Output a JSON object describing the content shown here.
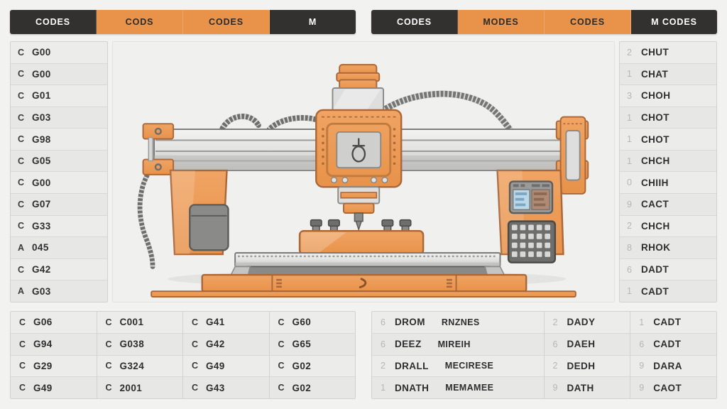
{
  "theme": {
    "accent": "#e8924a",
    "dark": "#333130",
    "background": "#f2f2f0",
    "row_light": "#ececea",
    "row_alt": "#e7e7e5",
    "border": "#d2d2d0",
    "text": "#2e2e2e",
    "faint_text": "#b6b6b4",
    "steel_light": "#e9e9e7",
    "steel_mid": "#b8b8b6",
    "steel_dark": "#6e6e6c"
  },
  "header": {
    "left_tabs": [
      {
        "label": "CODES",
        "style": "dark"
      },
      {
        "label": "CODS",
        "style": "accent"
      },
      {
        "label": "CODES",
        "style": "accent"
      },
      {
        "label": "M",
        "style": "dark"
      }
    ],
    "right_tabs": [
      {
        "label": "CODES",
        "style": "dark"
      },
      {
        "label": "MODES",
        "style": "accent"
      },
      {
        "label": "CODES",
        "style": "accent"
      },
      {
        "label": "M CODES",
        "style": "dark"
      }
    ]
  },
  "left_sidebar": {
    "rows": [
      {
        "prefix": "C",
        "value": "G00"
      },
      {
        "prefix": "C",
        "value": "G00"
      },
      {
        "prefix": "C",
        "value": "G01"
      },
      {
        "prefix": "C",
        "value": "G03"
      },
      {
        "prefix": "C",
        "value": "G98"
      },
      {
        "prefix": "C",
        "value": "G05"
      },
      {
        "prefix": "C",
        "value": "G00"
      },
      {
        "prefix": "C",
        "value": "G07"
      },
      {
        "prefix": "C",
        "value": "G33"
      },
      {
        "prefix": "A",
        "value": "045"
      },
      {
        "prefix": "C",
        "value": "G42"
      },
      {
        "prefix": "A",
        "value": "G03"
      }
    ]
  },
  "right_sidebar": {
    "rows": [
      {
        "prefix": "2",
        "value": "CHUT"
      },
      {
        "prefix": "1",
        "value": "CHAT"
      },
      {
        "prefix": "3",
        "value": "CHOH"
      },
      {
        "prefix": "1",
        "value": "CHOT"
      },
      {
        "prefix": "1",
        "value": "CHOT"
      },
      {
        "prefix": "1",
        "value": "CHCH"
      },
      {
        "prefix": "0",
        "value": "CHIIH"
      },
      {
        "prefix": "9",
        "value": "CACT"
      },
      {
        "prefix": "2",
        "value": "CHCH"
      },
      {
        "prefix": "8",
        "value": "RHOK"
      },
      {
        "prefix": "6",
        "value": "DADT"
      },
      {
        "prefix": "1",
        "value": "CADT"
      }
    ]
  },
  "bottom_left_panel": {
    "columns": [
      {
        "rows": [
          {
            "prefix": "C",
            "value": "G06"
          },
          {
            "prefix": "C",
            "value": "G94"
          },
          {
            "prefix": "C",
            "value": "G29"
          },
          {
            "prefix": "C",
            "value": "G49"
          }
        ]
      },
      {
        "rows": [
          {
            "prefix": "C",
            "value": "C001"
          },
          {
            "prefix": "C",
            "value": "G038"
          },
          {
            "prefix": "C",
            "value": "G324"
          },
          {
            "prefix": "C",
            "value": "2001"
          }
        ]
      },
      {
        "rows": [
          {
            "prefix": "C",
            "value": "G41"
          },
          {
            "prefix": "C",
            "value": "G42"
          },
          {
            "prefix": "C",
            "value": "G49"
          },
          {
            "prefix": "C",
            "value": "G43"
          }
        ]
      },
      {
        "rows": [
          {
            "prefix": "C",
            "value": "G60"
          },
          {
            "prefix": "C",
            "value": "G65"
          },
          {
            "prefix": "C",
            "value": "G02"
          },
          {
            "prefix": "C",
            "value": "G02"
          }
        ]
      }
    ]
  },
  "bottom_right_panel": {
    "columns": [
      {
        "rows": [
          {
            "prefix": "6",
            "value": "DROM",
            "secondary": "RNZNES"
          },
          {
            "prefix": "6",
            "value": "DEEZ",
            "secondary": "MIREIH"
          },
          {
            "prefix": "2",
            "value": "DRALL",
            "secondary": "MECIRESE"
          },
          {
            "prefix": "1",
            "value": "DNATH",
            "secondary": "MEMAMEE"
          }
        ]
      },
      {
        "rows": [
          {
            "prefix": "2",
            "value": "DADY"
          },
          {
            "prefix": "6",
            "value": "DAEH"
          },
          {
            "prefix": "2",
            "value": "DEDH"
          },
          {
            "prefix": "9",
            "value": "DATH"
          }
        ]
      },
      {
        "rows": [
          {
            "prefix": "1",
            "value": "CADT"
          },
          {
            "prefix": "6",
            "value": "CADT"
          },
          {
            "prefix": "9",
            "value": "DARA"
          },
          {
            "prefix": "9",
            "value": "CAOT"
          }
        ]
      }
    ]
  },
  "illustration": {
    "name": "cnc-milling-machine",
    "parts": [
      "gantry-rail",
      "spindle-head",
      "spindle-display",
      "cable-chain",
      "left-column",
      "right-column",
      "control-panel-screen",
      "control-panel-keypad",
      "machine-bed",
      "workpiece",
      "clamps",
      "base"
    ]
  }
}
